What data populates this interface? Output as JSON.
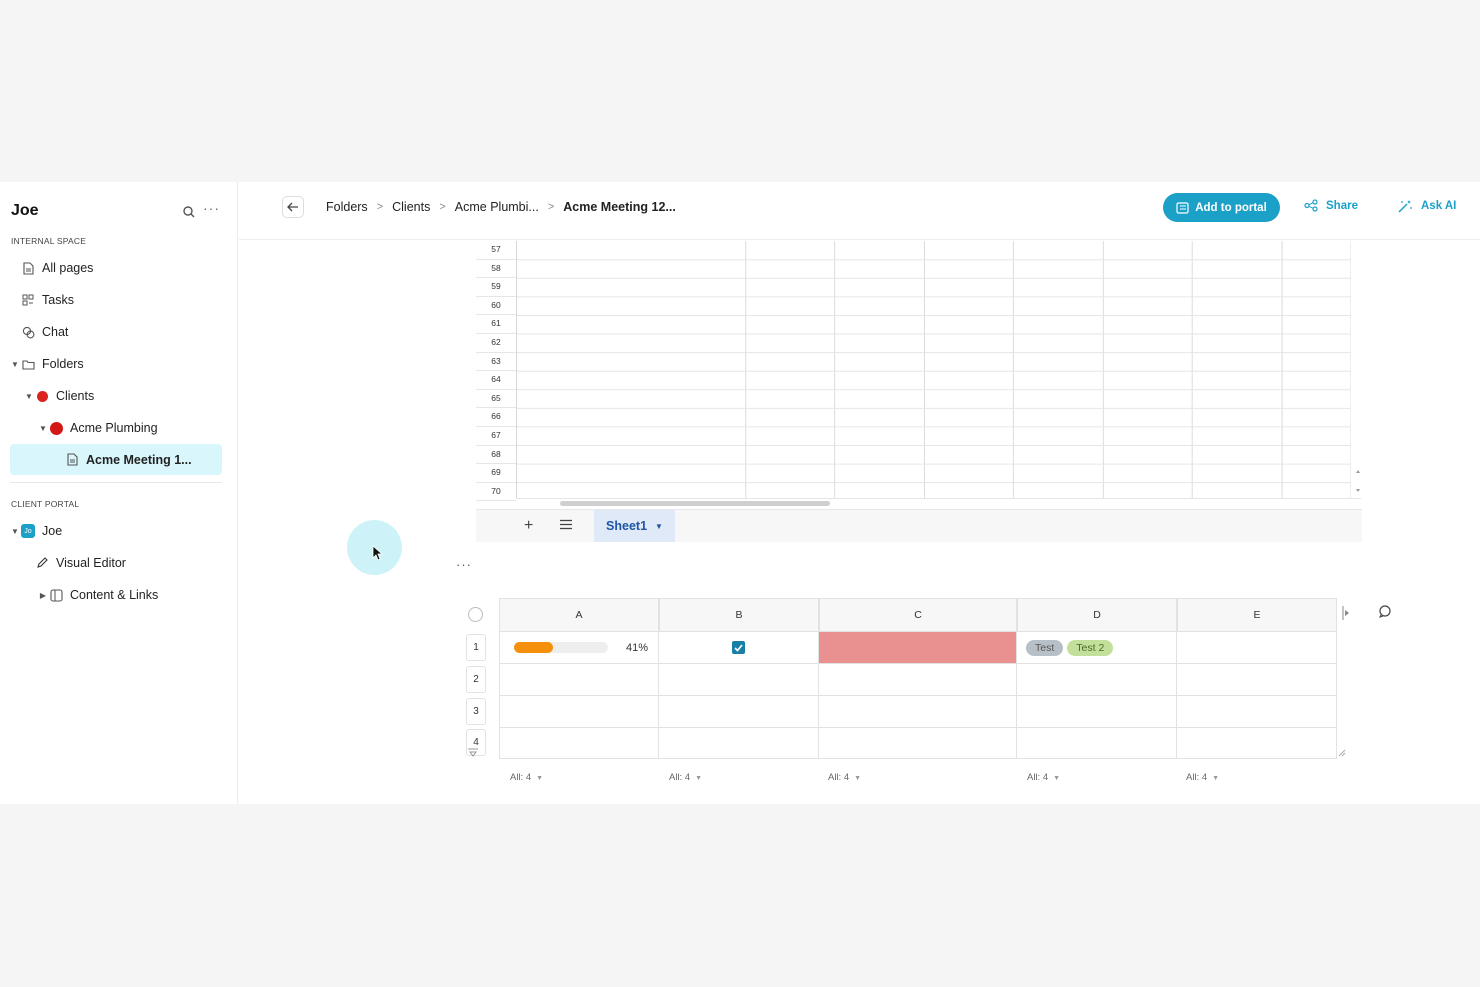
{
  "sidebar": {
    "workspace_name": "Joe",
    "internal_label": "INTERNAL SPACE",
    "items": [
      {
        "label": "All pages"
      },
      {
        "label": "Tasks"
      },
      {
        "label": "Chat"
      },
      {
        "label": "Folders"
      },
      {
        "label": "Clients"
      },
      {
        "label": "Acme Plumbing"
      },
      {
        "label": "Acme Meeting 1..."
      }
    ],
    "portal_label": "CLIENT PORTAL",
    "portal_items": [
      {
        "label": "Joe",
        "badge": "Jo"
      },
      {
        "label": "Visual Editor"
      },
      {
        "label": "Content & Links"
      }
    ]
  },
  "topbar": {
    "breadcrumbs": [
      "Folders",
      "Clients",
      "Acme Plumbi...",
      "Acme Meeting 12..."
    ],
    "add_to_portal": "Add to portal",
    "share": "Share",
    "ask_ai": "Ask AI"
  },
  "spreadsheet": {
    "row_numbers": [
      "57",
      "58",
      "59",
      "60",
      "61",
      "62",
      "63",
      "64",
      "65",
      "66",
      "67",
      "68",
      "69",
      "70"
    ],
    "tab_name": "Sheet1"
  },
  "table": {
    "columns": [
      "A",
      "B",
      "C",
      "D",
      "E"
    ],
    "rows": [
      "1",
      "2",
      "3",
      "4"
    ],
    "progress_percent": 41,
    "progress_label": "41%",
    "checkbox_checked": true,
    "fill_color": "#e99090",
    "tags": [
      "Test",
      "Test 2"
    ],
    "tag_colors": [
      "#b7bfc7",
      "#c3e09a"
    ],
    "aggregates": [
      "All: 4",
      "All: 4",
      "All: 4",
      "All: 4",
      "All: 4"
    ]
  },
  "colors": {
    "accent": "#1ba0c8",
    "progress": "#f5900d"
  }
}
